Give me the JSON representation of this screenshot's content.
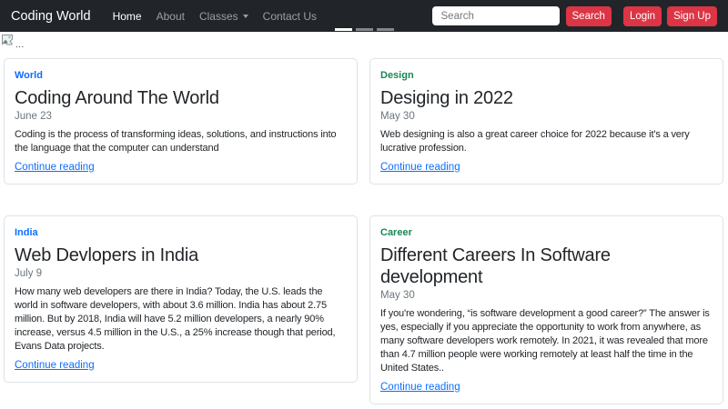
{
  "navbar": {
    "brand": "Coding World",
    "items": [
      {
        "label": "Home",
        "active": true
      },
      {
        "label": "About",
        "active": false
      },
      {
        "label": "Classes",
        "active": false,
        "dropdown": true
      },
      {
        "label": "Contact Us",
        "active": false
      }
    ],
    "search_placeholder": "Search",
    "search_button": "Search",
    "login_button": "Login",
    "signup_button": "Sign Up"
  },
  "carousel": {
    "image_alt": "...",
    "indicator_count": 3,
    "active_indicator": 1
  },
  "cards": [
    {
      "tag": "World",
      "tag_color": "#0d6efd",
      "title": "Coding Around The World",
      "date": "June 23",
      "body": "Coding is the process of transforming ideas, solutions, and instructions into the language that the computer can understand",
      "link": "Continue reading"
    },
    {
      "tag": "Design",
      "tag_color": "#198754",
      "title": "Desiging in 2022",
      "date": "May 30",
      "body": "Web designing is also a great career choice for 2022 because it's a very lucrative profession.",
      "link": "Continue reading"
    },
    {
      "tag": "India",
      "tag_color": "#0d6efd",
      "title": "Web Devlopers in India",
      "date": "July 9",
      "body": "How many web developers are there in India? Today, the U.S. leads the world in software developers, with about 3.6 million. India has about 2.75 million. But by 2018, India will have 5.2 million developers, a nearly 90% increase, versus 4.5 million in the U.S., a 25% increase though that period, Evans Data projects.",
      "link": "Continue reading"
    },
    {
      "tag": "Career",
      "tag_color": "#198754",
      "title": "Different Careers In Software development",
      "date": "May 30",
      "body": "If you're wondering, “is software development a good career?” The answer is yes, especially if you appreciate the opportunity to work from anywhere, as many software developers work remotely. In 2021, it was revealed that more than 4.7 million people were working remotely at least half the time in the United States..",
      "link": "Continue reading"
    }
  ],
  "colors": {
    "navbar_bg": "#212529",
    "button_red": "#dc3545",
    "link_blue": "#0d6efd",
    "tag_blue": "#0d6efd",
    "tag_green": "#198754",
    "date_gray": "#6c757d",
    "card_border": "#dee2e6"
  }
}
